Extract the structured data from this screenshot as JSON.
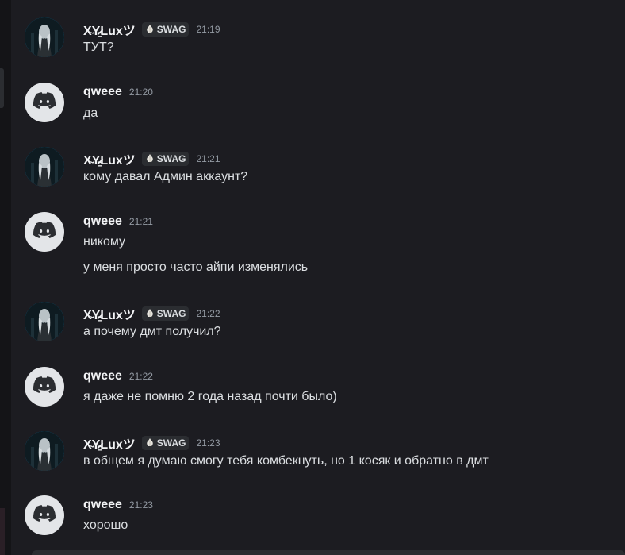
{
  "messages": [
    {
      "author": "X̴Y̴̷̱Luxツ",
      "tag": "SWAG",
      "time": "21:19",
      "lines": [
        "ТУТ?"
      ]
    },
    {
      "author": "qweee",
      "time": "21:20",
      "lines": [
        "да"
      ]
    },
    {
      "author": "X̴Y̴̷̱Luxツ",
      "tag": "SWAG",
      "time": "21:21",
      "lines": [
        "кому давал Админ аккаунт?"
      ]
    },
    {
      "author": "qweee",
      "time": "21:21",
      "lines": [
        "никому",
        "у меня просто часто айпи изменялись"
      ]
    },
    {
      "author": "X̴Y̴̷̱Luxツ",
      "tag": "SWAG",
      "time": "21:22",
      "lines": [
        "а почему дмт получил?"
      ]
    },
    {
      "author": "qweee",
      "time": "21:22",
      "lines": [
        "я даже не помню 2 года назад почти было)"
      ]
    },
    {
      "author": "X̴Y̴̷̱Luxツ",
      "tag": "SWAG",
      "time": "21:23",
      "lines": [
        "в общем я думаю смогу тебя комбекнуть, но 1 косяк и обратно в дмт"
      ]
    },
    {
      "author": "qweee",
      "time": "21:23",
      "lines": [
        "хорошо"
      ]
    }
  ],
  "icons": {
    "lux_avatar": "profile-photo-icon",
    "qweee_avatar": "discord-logo-icon",
    "tag_icon": "garlic-icon"
  },
  "colors": {
    "background": "#1c1c21",
    "username": "#f2f3f5",
    "timestamp": "#949ba4",
    "text": "#dbdee1",
    "lux_ring": "#1e8bc3",
    "tag_bg": "#2b2d31"
  }
}
